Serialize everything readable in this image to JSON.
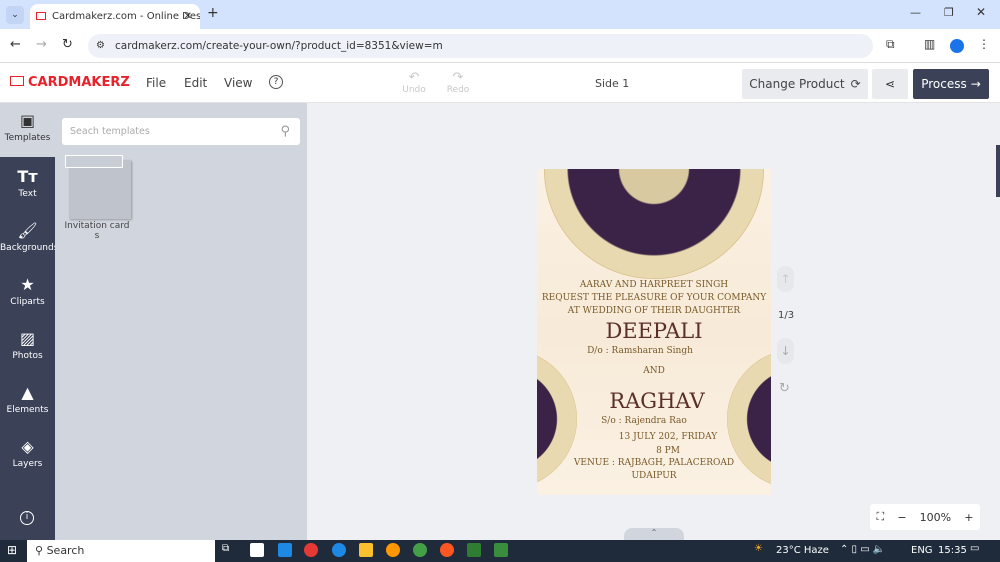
{
  "browser": {
    "tab_title": "Cardmakerz.com - Online Desig",
    "url": "cardmakerz.com/create-your-own/?product_id=8351&view=m"
  },
  "app": {
    "logo": "CARDMAKERZ",
    "menu": [
      "File",
      "Edit",
      "View"
    ],
    "undo": "Undo",
    "redo": "Redo",
    "side_label": "Side 1",
    "change_product": "Change Product",
    "process": "Process",
    "accent": "#e8212a"
  },
  "sidebar": {
    "items": [
      {
        "label": "Templates",
        "icon": "id-card-icon"
      },
      {
        "label": "Text",
        "icon": "text-icon"
      },
      {
        "label": "Backgrounds",
        "icon": "paint-roller-icon"
      },
      {
        "label": "Cliparts",
        "icon": "star-icon"
      },
      {
        "label": "Photos",
        "icon": "image-icon"
      },
      {
        "label": "Elements",
        "icon": "shapes-icon"
      },
      {
        "label": "Layers",
        "icon": "layers-icon"
      }
    ]
  },
  "panel": {
    "search_placeholder": "Seach templates",
    "template_label": "Invitation cards"
  },
  "card": {
    "lines": [
      "AARAV AND HARPREET SINGH",
      "REQUEST THE PLEASURE OF YOUR COMPANY",
      "AT WEDDING  OF THEIR DAUGHTER"
    ],
    "bride": "DEEPALI",
    "bride_parent": "D/o : Ramsharan Singh",
    "and": "AND",
    "groom": "RAGHAV",
    "groom_parent": "S/o : Rajendra  Rao",
    "date": "13 JULY 202, FRIDAY",
    "time": "8 PM",
    "venue": "VENUE : RAJBAGH, PALACEROAD",
    "city": "UDAIPUR"
  },
  "pager": "1/3",
  "zoom": "100%",
  "taskbar": {
    "search": "Search",
    "weather": "23°C  Haze",
    "lang": "ENG",
    "time": "15:35"
  }
}
